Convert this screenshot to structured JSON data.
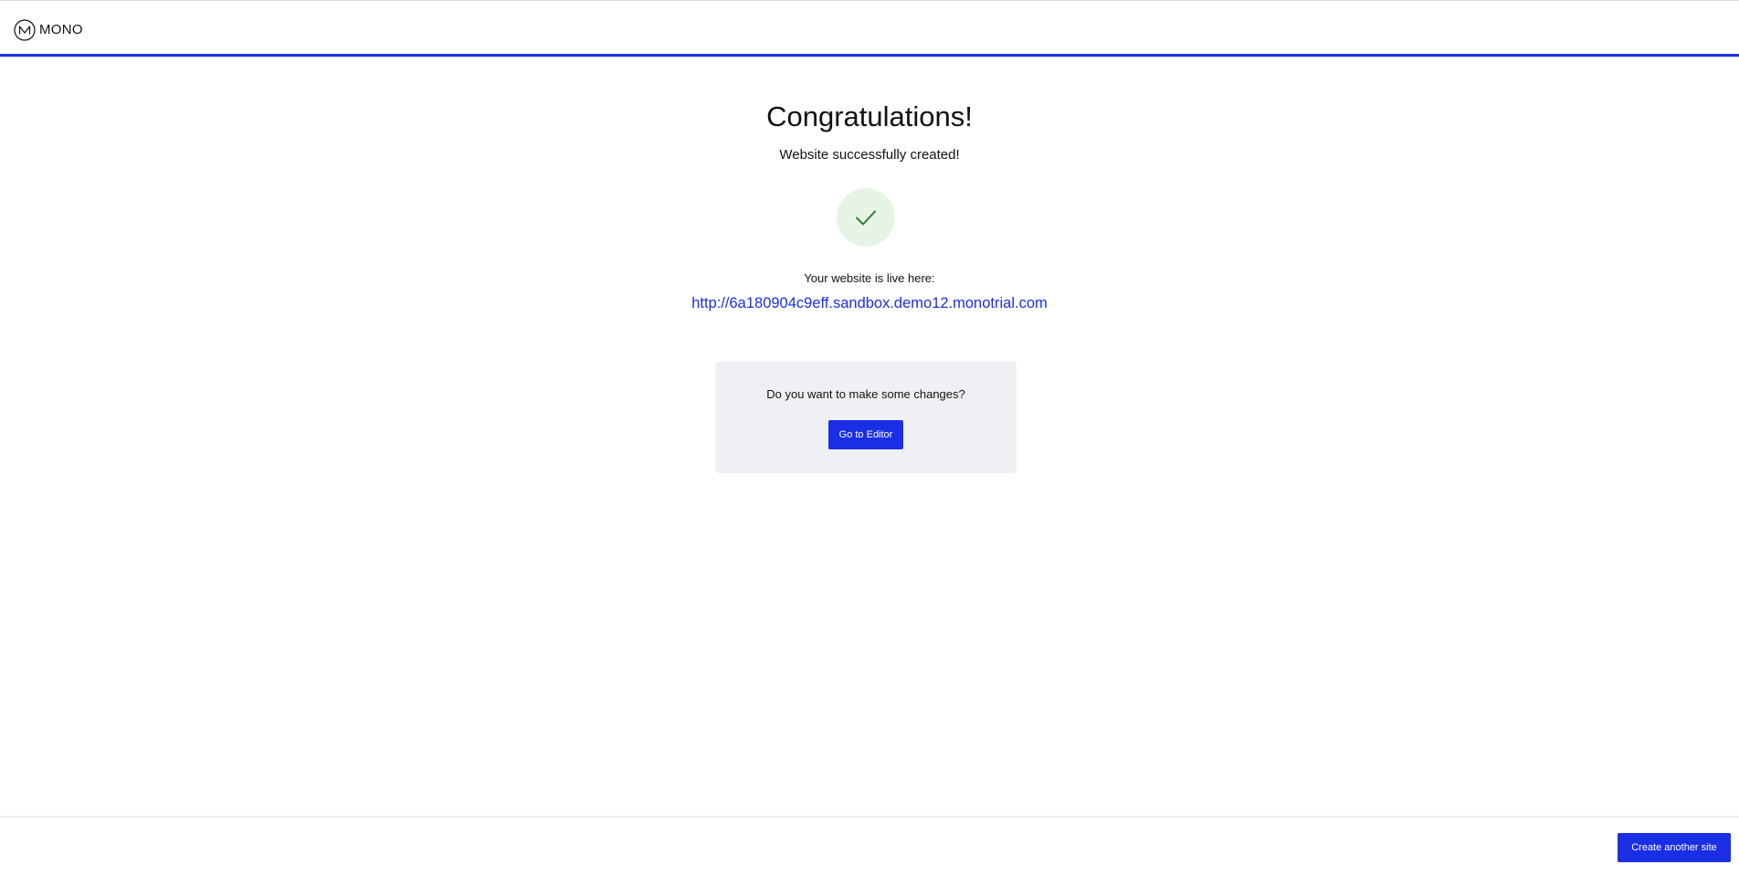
{
  "header": {
    "logo_text": "MONO"
  },
  "main": {
    "title": "Congratulations!",
    "subtitle": "Website successfully created!",
    "live_label": "Your website is live here:",
    "live_url": "http://6a180904c9eff.sandbox.demo12.monotrial.com"
  },
  "changes_card": {
    "question": "Do you want to make some changes?",
    "editor_button": "Go to Editor"
  },
  "footer": {
    "create_button": "Create another site"
  },
  "colors": {
    "accent": "#1a2ee6",
    "success_bg": "#e6f4e6",
    "success_check": "#2e7d32",
    "card_bg": "#eff0f3"
  },
  "icons": {
    "logo": "mono-logo-icon",
    "success": "check-icon"
  }
}
